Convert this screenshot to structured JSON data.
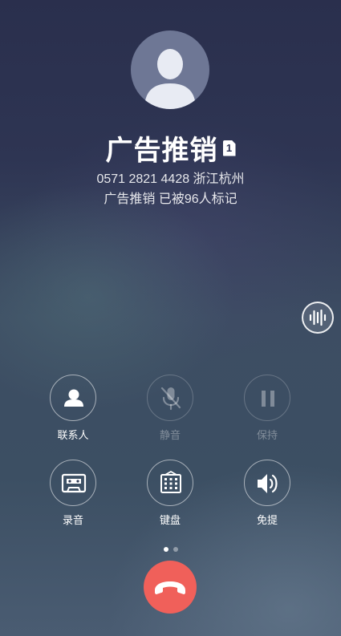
{
  "caller": {
    "name": "广告推销",
    "sim_badge": "1",
    "number_location": "0571 2821 4428 浙江杭州",
    "tag_info": "广告推销 已被96人标记"
  },
  "controls": {
    "row1": [
      {
        "label": "联系人",
        "icon": "contact-person-icon",
        "enabled": true
      },
      {
        "label": "静音",
        "icon": "mute-mic-icon",
        "enabled": false
      },
      {
        "label": "保持",
        "icon": "pause-icon",
        "enabled": false
      }
    ],
    "row2": [
      {
        "label": "录音",
        "icon": "cassette-record-icon",
        "enabled": true
      },
      {
        "label": "键盘",
        "icon": "keypad-icon",
        "enabled": true
      },
      {
        "label": "免提",
        "icon": "speaker-icon",
        "enabled": true
      }
    ]
  },
  "pager": {
    "pages": 2,
    "current": 1
  },
  "colors": {
    "hangup": "#f0605a",
    "background_top": "#2a2f4d",
    "background_bottom": "#4a5c72"
  }
}
